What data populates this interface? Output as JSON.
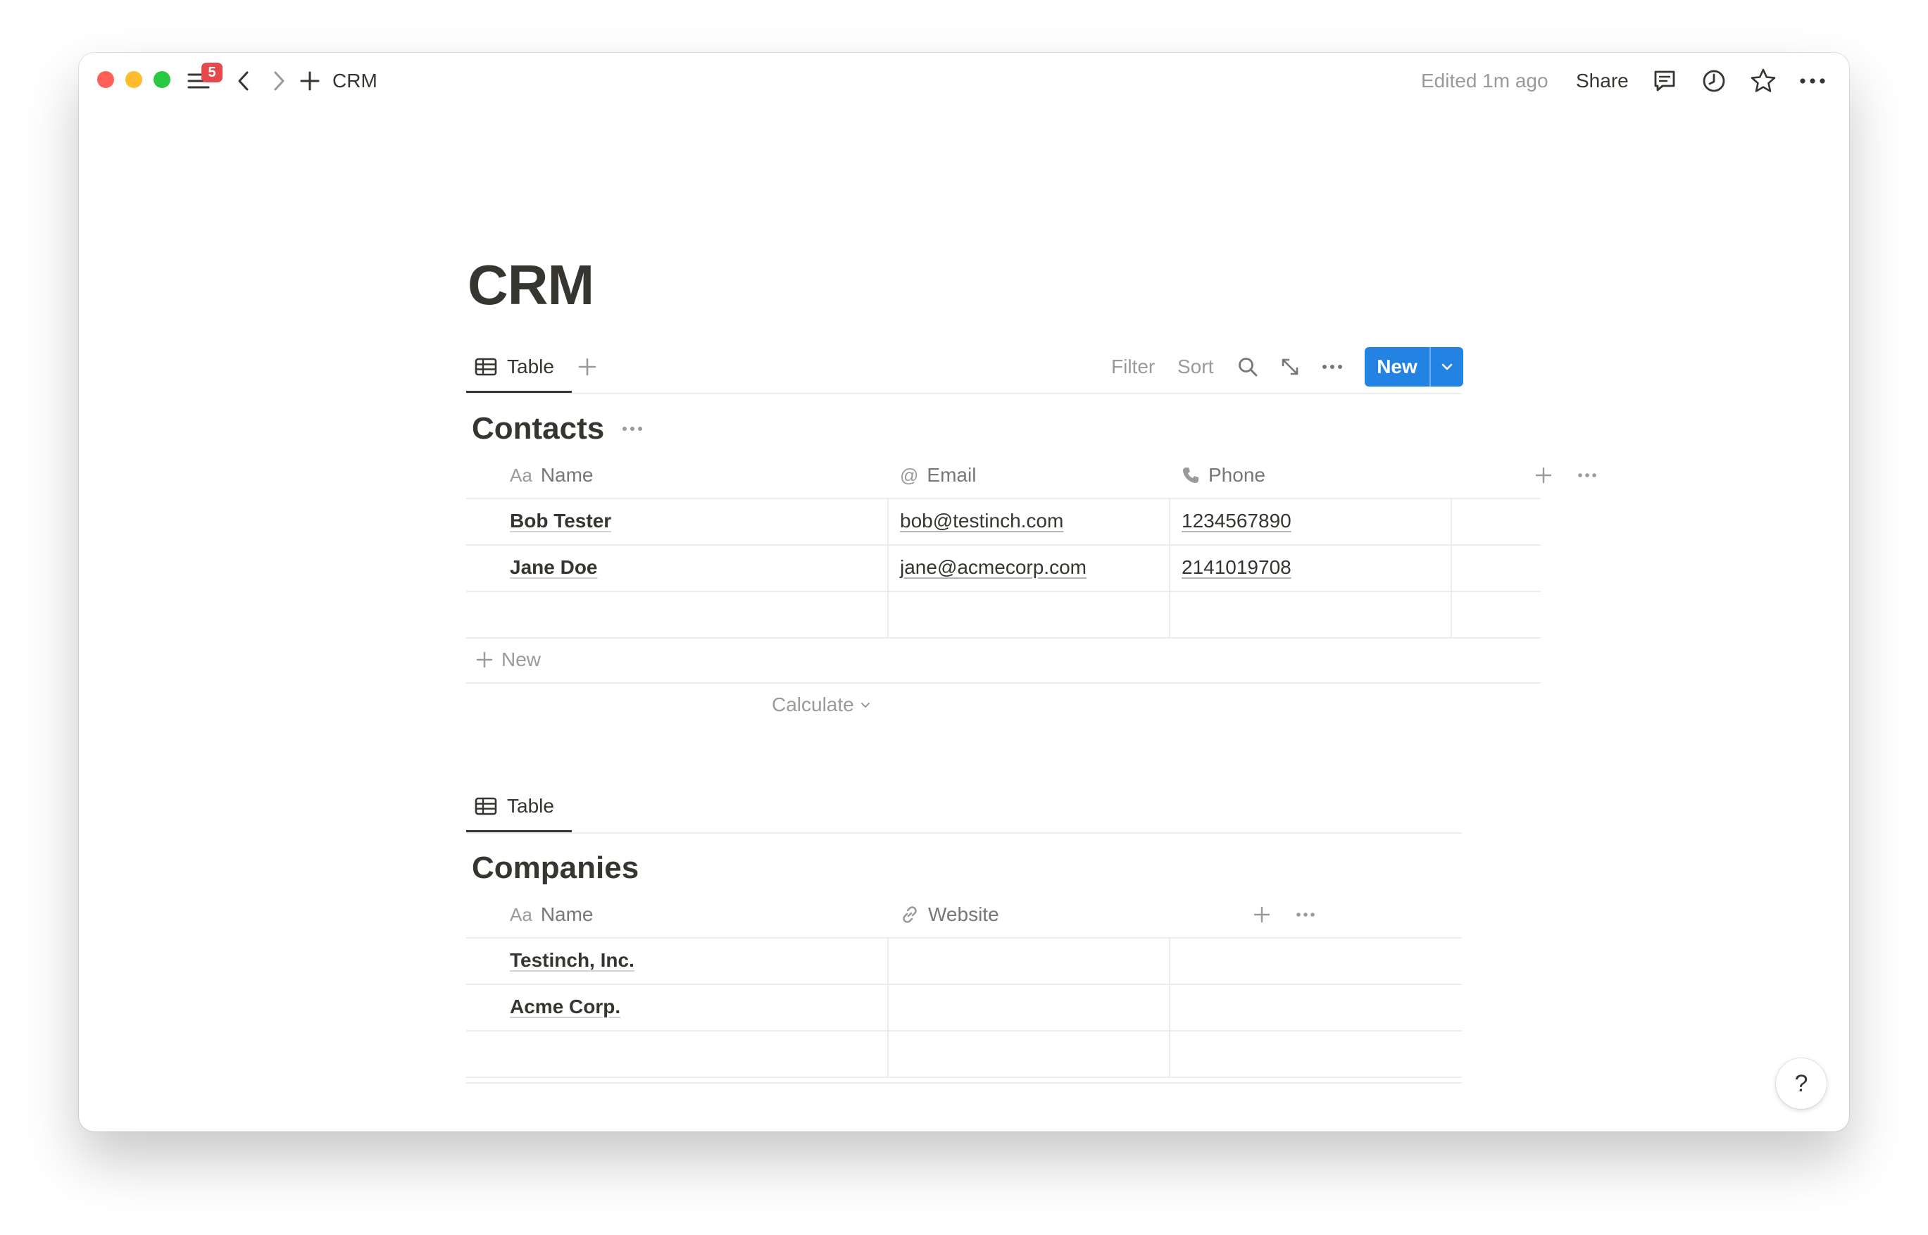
{
  "window": {
    "traffic_lights": {
      "close": "#ff5f57",
      "minimize": "#febc2e",
      "maximize": "#28c840"
    },
    "notification_count": "5",
    "breadcrumb": "CRM",
    "edited_label": "Edited 1m ago",
    "share_label": "Share",
    "icons": [
      "sidebar-menu-icon",
      "back-arrow-icon",
      "forward-arrow-icon",
      "add-icon",
      "comment-icon",
      "history-clock-icon",
      "star-icon",
      "more-icon"
    ]
  },
  "page": {
    "title": "CRM",
    "accent_color": "#2383e2"
  },
  "contacts_view": {
    "tab_label": "Table",
    "toolbar": {
      "filter_label": "Filter",
      "sort_label": "Sort",
      "new_label": "New"
    },
    "title": "Contacts",
    "columns": [
      {
        "icon": "text-property-icon",
        "icon_text": "Aa",
        "label": "Name"
      },
      {
        "icon": "at-sign-icon",
        "icon_text": "@",
        "label": "Email"
      },
      {
        "icon": "phone-icon",
        "label": "Phone"
      }
    ],
    "rows": [
      {
        "name": "Bob Tester",
        "email": "bob@testinch.com",
        "phone": "1234567890"
      },
      {
        "name": "Jane Doe",
        "email": "jane@acmecorp.com",
        "phone": "2141019708"
      }
    ],
    "new_row_label": "New",
    "calculate_label": "Calculate"
  },
  "companies_view": {
    "tab_label": "Table",
    "title": "Companies",
    "columns": [
      {
        "icon": "text-property-icon",
        "icon_text": "Aa",
        "label": "Name"
      },
      {
        "icon": "link-icon",
        "label": "Website"
      }
    ],
    "rows": [
      {
        "name": "Testinch, Inc.",
        "website": ""
      },
      {
        "name": "Acme Corp.",
        "website": ""
      }
    ]
  },
  "help_label": "?"
}
